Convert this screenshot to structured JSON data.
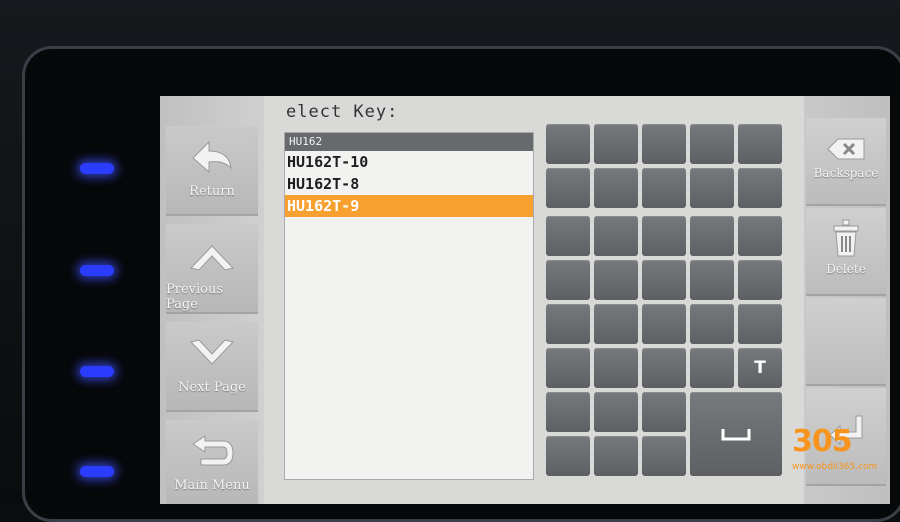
{
  "title": "elect Key:",
  "nav": {
    "return": "Return",
    "previous_page": "Previous Page",
    "next_page": "Next Page",
    "main_menu": "Main Menu"
  },
  "list": {
    "header": "HU162",
    "items": [
      "HU162T-10",
      "HU162T-8",
      "HU162T-9"
    ],
    "selected_index": 2
  },
  "keypad": {
    "key_t": "T",
    "space_icon": "space-bar-icon"
  },
  "actions": {
    "backspace": "Backspace",
    "delete": "Delete"
  },
  "watermark": {
    "number": "305",
    "url": "www.obdii365.com"
  },
  "colors": {
    "selection": "#f8a030",
    "led": "#2a3cff",
    "key": "#6a6d6f"
  }
}
